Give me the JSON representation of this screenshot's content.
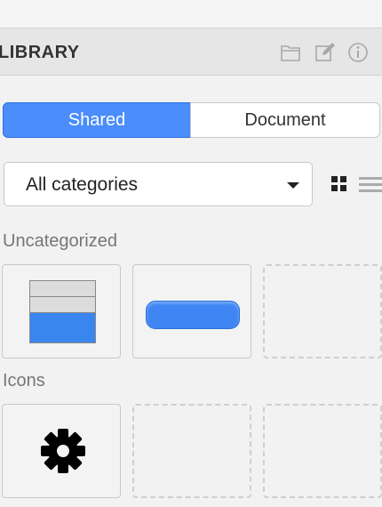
{
  "header": {
    "title": "LIBRARY",
    "icons": [
      "folder-icon",
      "edit-icon",
      "info-icon"
    ]
  },
  "segmented": {
    "shared_label": "Shared",
    "document_label": "Document",
    "selected": "Shared"
  },
  "category_select": {
    "value": "All categories"
  },
  "view_toggle": {
    "icons": [
      "grid-view-icon",
      "list-view-icon"
    ]
  },
  "sections": [
    {
      "label": "Uncategorized",
      "items": [
        "table-widget",
        "button-pill-widget",
        "empty-slot"
      ]
    },
    {
      "label": "Icons",
      "items": [
        "gear-icon",
        "empty-slot",
        "empty-slot"
      ]
    }
  ],
  "colors": {
    "accent": "#4a8dfb",
    "panel_bg": "#f2f2f2",
    "header_bg": "#e6e6e6",
    "text_muted": "#777777"
  }
}
